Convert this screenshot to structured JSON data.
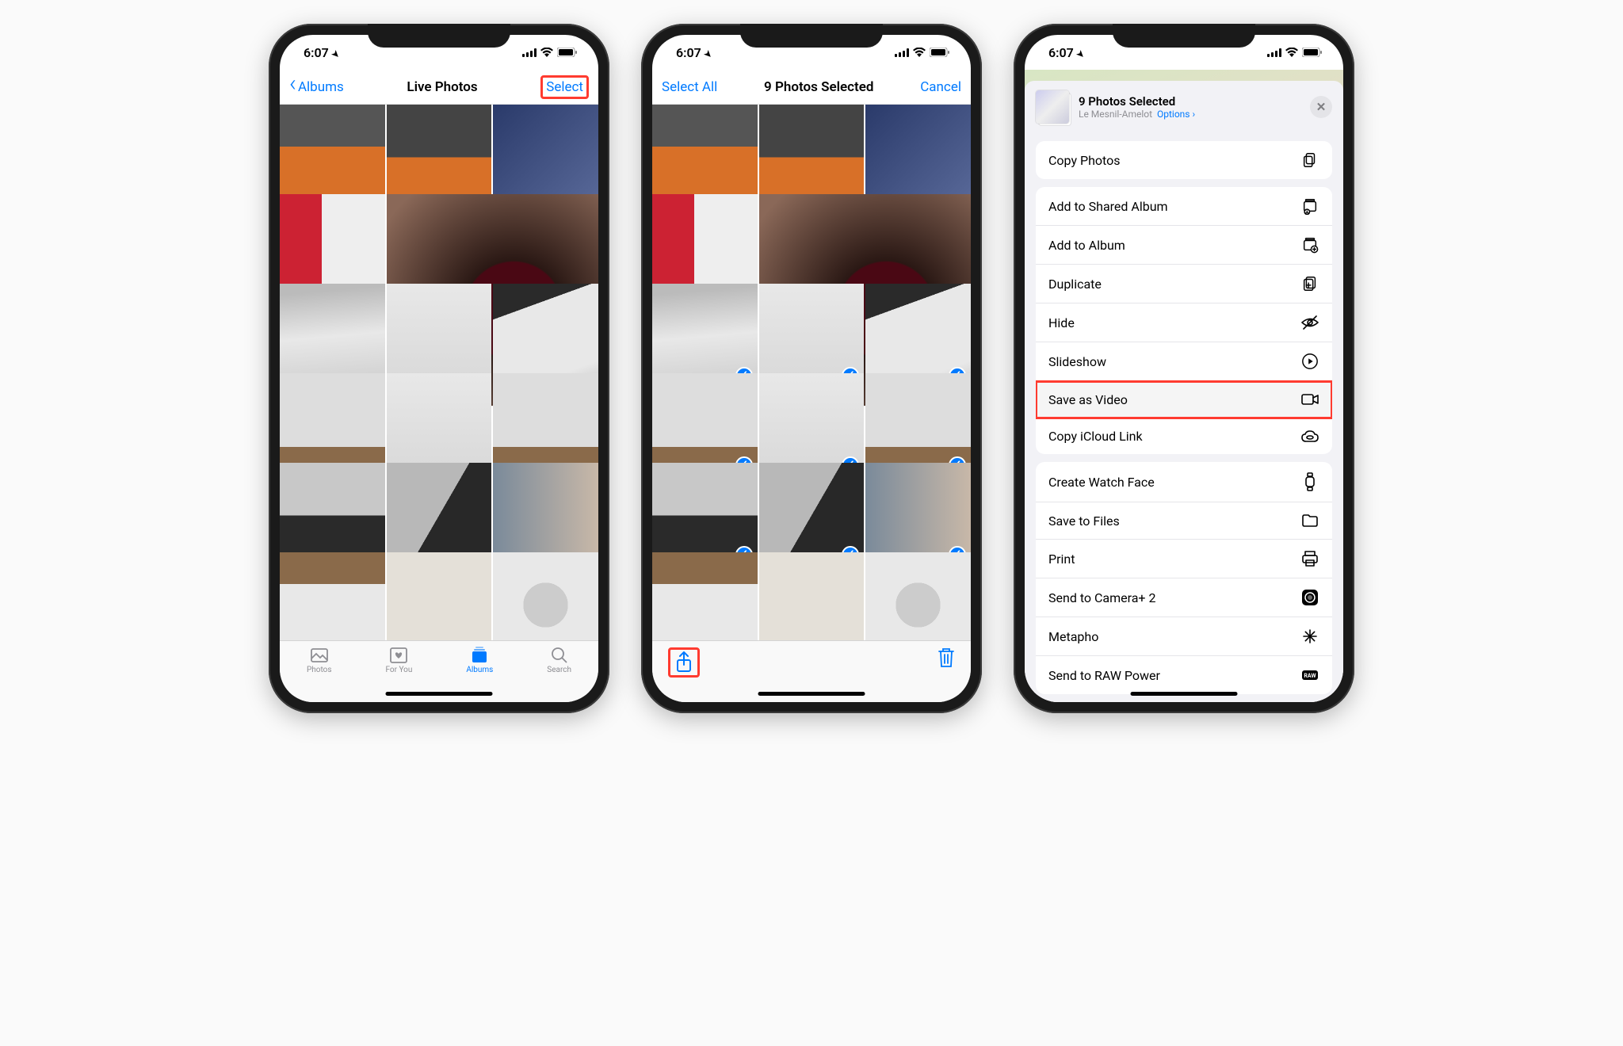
{
  "status": {
    "time": "6:07",
    "location_icon": "location-arrow"
  },
  "phone1": {
    "nav": {
      "back": "Albums",
      "title": "Live Photos",
      "right": "Select"
    },
    "tabs": [
      {
        "label": "Photos",
        "icon": "photo"
      },
      {
        "label": "For You",
        "icon": "heart-square"
      },
      {
        "label": "Albums",
        "icon": "stack"
      },
      {
        "label": "Search",
        "icon": "search"
      }
    ],
    "active_tab": 2
  },
  "phone2": {
    "nav": {
      "left": "Select All",
      "title": "9 Photos Selected",
      "right": "Cancel"
    },
    "selected_indexes": [
      5,
      6,
      7,
      8,
      9,
      10,
      11,
      12,
      13
    ]
  },
  "phone3": {
    "header": {
      "title": "9 Photos Selected",
      "subtitle": "Le Mesnil-Amelot",
      "options": "Options"
    },
    "groups": [
      [
        {
          "label": "Copy Photos",
          "icon": "copy"
        }
      ],
      [
        {
          "label": "Add to Shared Album",
          "icon": "shared-album"
        },
        {
          "label": "Add to Album",
          "icon": "add-album"
        },
        {
          "label": "Duplicate",
          "icon": "duplicate"
        },
        {
          "label": "Hide",
          "icon": "eye-slash"
        },
        {
          "label": "Slideshow",
          "icon": "play-circle"
        },
        {
          "label": "Save as Video",
          "icon": "video",
          "highlight": true
        },
        {
          "label": "Copy iCloud Link",
          "icon": "cloud-link"
        }
      ],
      [
        {
          "label": "Create Watch Face",
          "icon": "watch"
        },
        {
          "label": "Save to Files",
          "icon": "folder"
        },
        {
          "label": "Print",
          "icon": "printer"
        },
        {
          "label": "Send to Camera+ 2",
          "icon": "camera-app"
        },
        {
          "label": "Metapho",
          "icon": "sparkle"
        },
        {
          "label": "Send to RAW Power",
          "icon": "raw"
        }
      ]
    ]
  },
  "thumbs": [
    "p-cat1",
    "p-cat2",
    "p-cat3",
    "p-red",
    "p-wine",
    "p-mac1",
    "p-mac2",
    "p-hand",
    "p-box",
    "p-mac2",
    "p-box",
    "p-kb",
    "p-kb2",
    "p-ppl",
    "p-box2",
    "p-box3",
    "p-wire"
  ]
}
